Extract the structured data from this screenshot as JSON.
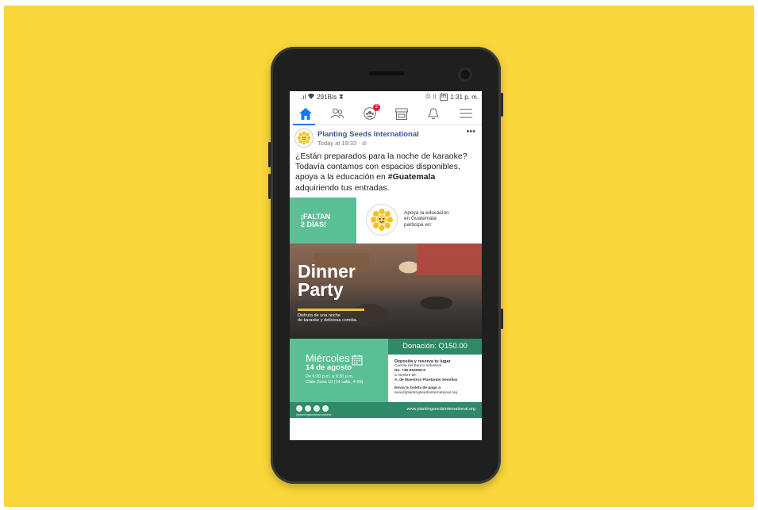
{
  "status_bar": {
    "signal": ".ıl",
    "speed": "291B/s",
    "hourglass": "⧗",
    "icons_right": "⏲ ▯ ",
    "battery": "85",
    "time": "1:31 p. m."
  },
  "nav": {
    "items": [
      "home-icon",
      "friends-icon",
      "groups-icon",
      "marketplace-icon",
      "notifications-icon",
      "menu-icon"
    ],
    "groups_badge": "2",
    "accent": "#1877f2"
  },
  "post": {
    "page_name": "Planting Seeds International",
    "time": "Today at 19:33 · ",
    "text_line1": "¿Están preparados para la noche de karaoke?",
    "text_line2": "Todavía contamos con espacios disponibles,",
    "text_line3_prefix": "apoya a la educación en ",
    "text_hashtag": "#Guatemala",
    "text_line4": "adquiriendo tus entradas."
  },
  "flyer": {
    "faltan_line1": "¡FALTAN",
    "faltan_line2": "2 DÍAS!",
    "apoya_line1": "Apoya la educación",
    "apoya_line2": "en Guatemala",
    "apoya_line3": "participa en:",
    "dinner": "Dinner",
    "party": "Party",
    "disfruta_line1": "Disfruta de una noche",
    "disfruta_line2": "de karaoke y deliciosa comida.",
    "donacion": "Donación: Q150.00",
    "deposit_title": "Deposita y reserva tu lugar",
    "deposit_line1": "Cuenta del Banco Industrial",
    "deposit_line2": "No. 749-004099-6",
    "deposit_line3": "a nombre de:",
    "deposit_line4": "A. de Maestros Plantando Semillas",
    "deposit_line5": "Envía tu boleta de pago a:",
    "deposit_line6": "seac@plantingseedsinternational.org",
    "miercoles": "Miércoles",
    "agosto": "14 de agosto",
    "hora_line1": "De 6:30 p.m. a 9:30 p.m.",
    "hora_line2": "Chile Zona 10 (14 calle, 4-69)",
    "handle": "@plantingseedsinternational",
    "site": "www.plantingseedsinternational.org",
    "green": "#5bbf95",
    "dark_green": "#2e8a68",
    "yellow": "#f2c12e"
  }
}
